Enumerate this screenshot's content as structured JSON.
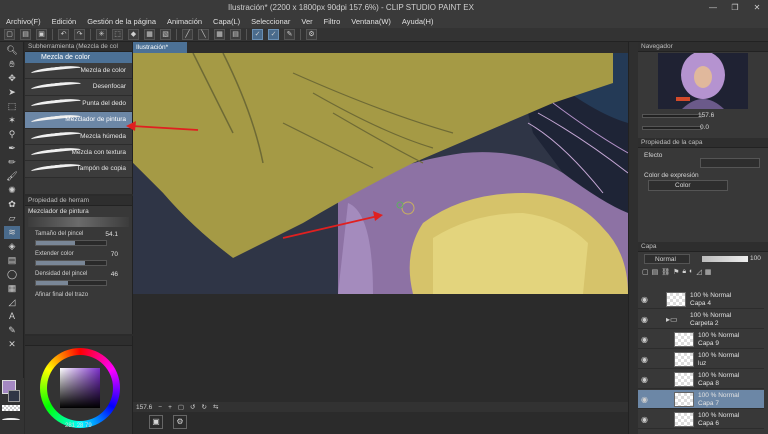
{
  "window": {
    "title": "Ilustración* (2200 x 1800px 90dpi 157.6%) - CLIP STUDIO PAINT EX",
    "min": "—",
    "max": "❐",
    "close": "✕"
  },
  "menu": [
    "Archivo(F)",
    "Edición",
    "Gestión de la página",
    "Animación",
    "Capa(L)",
    "Seleccionar",
    "Ver",
    "Filtro",
    "Ventana(W)",
    "Ayuda(H)"
  ],
  "subtool": {
    "header": "Subherramienta (Mezcla de col",
    "group": "Mezcla de color",
    "brushes": [
      {
        "label": "Mezcla de color",
        "selected": false
      },
      {
        "label": "Desenfocar",
        "selected": false
      },
      {
        "label": "Punta del dedo",
        "selected": false
      },
      {
        "label": "Mezclador de pintura",
        "selected": true
      },
      {
        "label": "Mezcla húmeda",
        "selected": false
      },
      {
        "label": "Mezcla con textura",
        "selected": false
      },
      {
        "label": "Tampón de copia",
        "selected": false
      }
    ]
  },
  "toolprop": {
    "header": "Propiedad de herram",
    "name": "Mezclador de pintura",
    "rows": [
      {
        "label": "Tamaño del pincel",
        "value": "54.1",
        "level": 0.55
      },
      {
        "label": "Extender color",
        "value": "70",
        "level": 0.7
      },
      {
        "label": "Densidad del pincel",
        "value": "46",
        "level": 0.46
      }
    ],
    "footer": "Afinar final del trazo"
  },
  "color": {
    "h": "281",
    "s": "28",
    "v": "79",
    "main": "#a488c2"
  },
  "canvas": {
    "tab": "Ilustración*",
    "zoom": "157.6"
  },
  "navigator": {
    "title": "Navegador",
    "zoom": "157.6",
    "angle": "0.0"
  },
  "layerprop": {
    "title": "Propiedad de la capa",
    "effect": "Efecto",
    "expr_label": "Color de expresión",
    "expr_value": "Color"
  },
  "layers": {
    "title": "Capa",
    "blend": "Normal",
    "opacity": "100",
    "items": [
      {
        "l1": "100 % Normal",
        "l2": "Capa 4",
        "indent": 0,
        "selected": false,
        "folder": false
      },
      {
        "l1": "100 % Normal",
        "l2": "Carpeta 2",
        "indent": 0,
        "selected": false,
        "folder": true
      },
      {
        "l1": "100 % Normal",
        "l2": "Capa 9",
        "indent": 1,
        "selected": false,
        "folder": false
      },
      {
        "l1": "100 % Normal",
        "l2": "luz",
        "indent": 1,
        "selected": false,
        "folder": false
      },
      {
        "l1": "100 % Normal",
        "l2": "Capa 8",
        "indent": 1,
        "selected": false,
        "folder": false
      },
      {
        "l1": "100 % Normal",
        "l2": "Capa 7",
        "indent": 1,
        "selected": true,
        "folder": false
      },
      {
        "l1": "100 % Normal",
        "l2": "Capa 6",
        "indent": 1,
        "selected": false,
        "folder": false
      }
    ]
  },
  "colors": {
    "accent": "#4c7196",
    "selection": "#6c87a6",
    "annotation_arrow": "#e02020"
  }
}
